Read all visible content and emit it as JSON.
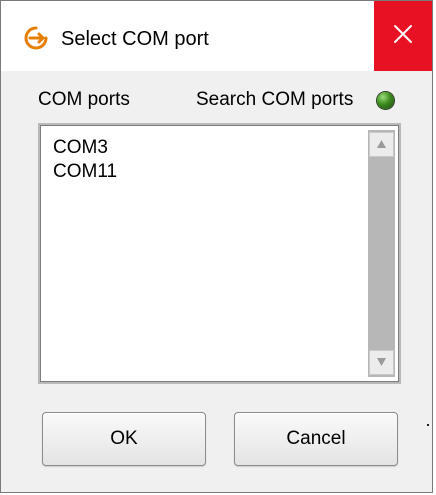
{
  "window": {
    "title": "Select COM port",
    "accent": "#e67e00",
    "close_color": "#e81123",
    "close_icon": "close-icon",
    "app_icon": "app-logo-icon"
  },
  "ports": {
    "label": "COM ports",
    "search_label": "Search COM ports",
    "search_status_color": "#3c8a1e",
    "items": [
      "COM3",
      "COM11"
    ]
  },
  "buttons": {
    "ok_label": "OK",
    "cancel_label": "Cancel"
  }
}
